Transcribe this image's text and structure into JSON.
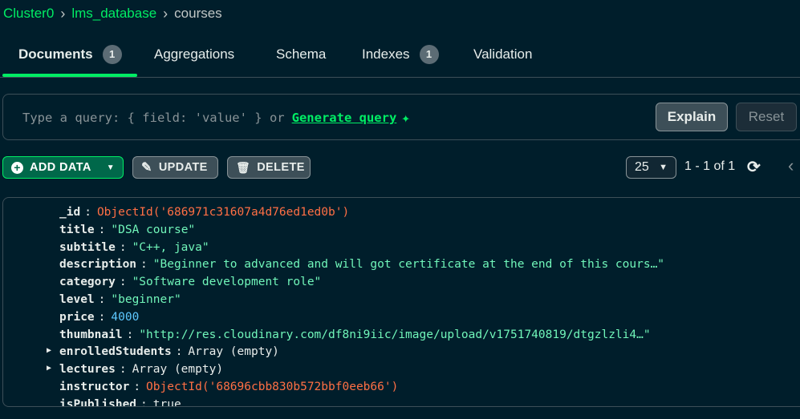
{
  "breadcrumb": {
    "cluster": "Cluster0",
    "database": "lms_database",
    "collection": "courses",
    "sep": "›"
  },
  "tabs": [
    {
      "label": "Documents",
      "badge": "1"
    },
    {
      "label": "Aggregations"
    },
    {
      "label": "Schema"
    },
    {
      "label": "Indexes",
      "badge": "1"
    },
    {
      "label": "Validation"
    }
  ],
  "query": {
    "placeholder": "Type a query: { field: 'value' } or",
    "generate_label": "Generate query",
    "spark_glyph": "✦",
    "explain_label": "Explain",
    "reset_label": "Reset"
  },
  "toolbar": {
    "add_label": "ADD DATA",
    "update_label": "UPDATE",
    "delete_label": "DELETE",
    "page_size": "25",
    "range": "1 - 1 of 1",
    "caret": "▼"
  },
  "icons": {
    "plus": "+",
    "pencil": "✎",
    "trash": "🗑",
    "refresh": "⟳",
    "prev": "‹",
    "expand": "▶"
  },
  "document": {
    "fields": [
      {
        "key": "_id",
        "value": "ObjectId('686971c31607a4d76ed1ed0b')",
        "type": "oid"
      },
      {
        "key": "title",
        "value": "\"DSA course\"",
        "type": "string"
      },
      {
        "key": "subtitle",
        "value": "\"C++, java\"",
        "type": "string"
      },
      {
        "key": "description",
        "value": "\"Beginner to advanced and will got certificate at the end of this cours…\"",
        "type": "string"
      },
      {
        "key": "category",
        "value": "\"Software development role\"",
        "type": "string"
      },
      {
        "key": "level",
        "value": "\"beginner\"",
        "type": "string"
      },
      {
        "key": "price",
        "value": "4000",
        "type": "number"
      },
      {
        "key": "thumbnail",
        "value": "\"http://res.cloudinary.com/df8ni9iic/image/upload/v1751740819/dtgzlzli4…\"",
        "type": "string"
      },
      {
        "key": "enrolledStudents",
        "value": "Array (empty)",
        "type": "array"
      },
      {
        "key": "lectures",
        "value": "Array (empty)",
        "type": "array"
      },
      {
        "key": "instructor",
        "value": "ObjectId('68696cbb830b572bbf0eeb66')",
        "type": "oid"
      },
      {
        "key": "isPublished",
        "value": "true",
        "type": "bool"
      }
    ]
  },
  "colors": {
    "accent": "#00ed64",
    "background": "#001e2b",
    "string": "#71f6ba",
    "number": "#5ec8ff",
    "objectid": "#ff6f44"
  }
}
